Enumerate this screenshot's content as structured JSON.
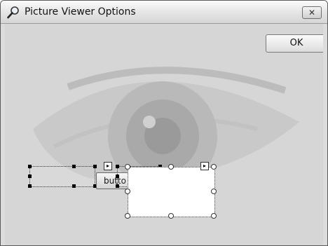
{
  "window": {
    "title": "Picture Viewer Options",
    "close_glyph": "✕",
    "icon": "magnifier-icon"
  },
  "buttons": {
    "ok_label": "OK",
    "designer_button_label": "butto"
  },
  "designer": {
    "smart_tag_glyph": "▸"
  },
  "colors": {
    "title_bar": "#e4e4e4",
    "client_bg": "#d8d8d8",
    "handle": "#000000"
  }
}
